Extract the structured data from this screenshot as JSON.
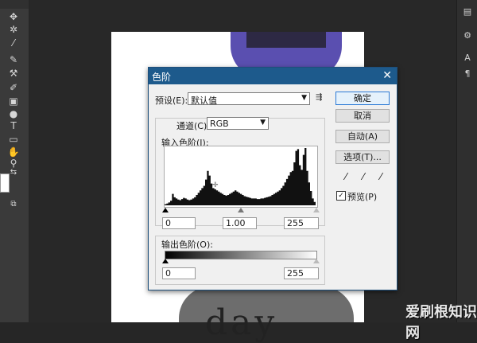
{
  "dialog": {
    "title": "色阶",
    "preset_label": "预设(E):",
    "preset_value": "默认值",
    "channel_label": "通道(C):",
    "channel_value": "RGB",
    "input_levels_label": "输入色阶(I):",
    "input_black": "0",
    "input_gamma": "1.00",
    "input_white": "255",
    "output_levels_label": "输出色阶(O):",
    "output_black": "0",
    "output_white": "255",
    "preview_label": "预览(P)",
    "preview_checked": true
  },
  "buttons": {
    "ok": "确定",
    "cancel": "取消",
    "auto": "自动(A)",
    "options": "选项(T)..."
  },
  "canvas": {
    "text": "day"
  },
  "watermark": "爱刷根知识网",
  "histogram": [
    2,
    3,
    5,
    8,
    20,
    14,
    12,
    10,
    9,
    11,
    13,
    12,
    10,
    9,
    10,
    12,
    14,
    18,
    22,
    26,
    30,
    34,
    45,
    60,
    52,
    38,
    30,
    28,
    26,
    24,
    22,
    20,
    18,
    17,
    18,
    20,
    22,
    24,
    26,
    24,
    22,
    20,
    18,
    16,
    15,
    14,
    13,
    12,
    12,
    12,
    11,
    11,
    12,
    12,
    13,
    14,
    15,
    16,
    18,
    20,
    22,
    24,
    26,
    30,
    34,
    40,
    46,
    52,
    58,
    60,
    75,
    95,
    98,
    70,
    62,
    88,
    100,
    60,
    40,
    25,
    12,
    6
  ]
}
